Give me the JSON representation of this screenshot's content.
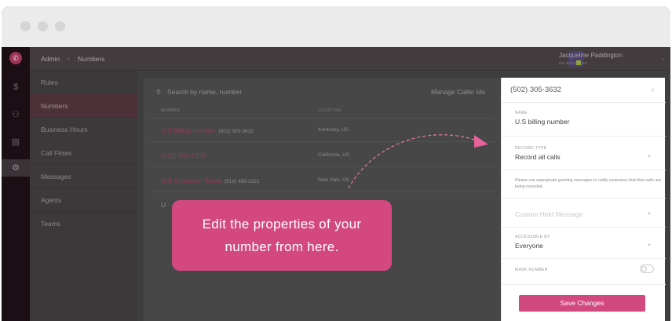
{
  "window": {
    "controls": [
      "close",
      "minimize",
      "maximize"
    ]
  },
  "rail": {
    "logo_icon": "phone-icon",
    "icons": [
      "dollar-icon",
      "people-icon",
      "card-icon",
      "gear-icon"
    ]
  },
  "breadcrumb": {
    "root": "Admin",
    "separator": "›",
    "current": "Numbers"
  },
  "user": {
    "name": "Jacqueline Paddington",
    "role": "ON BROWSER"
  },
  "sidebar": {
    "items": [
      {
        "label": "Rules"
      },
      {
        "label": "Numbers"
      },
      {
        "label": "Business Hours"
      },
      {
        "label": "Call Flows"
      },
      {
        "label": "Messages"
      },
      {
        "label": "Agents"
      },
      {
        "label": "Teams"
      }
    ],
    "active": "Numbers"
  },
  "main": {
    "search_placeholder": "Search by name, number",
    "manage_label": "Manage Caller Ids",
    "columns": {
      "number": "NUMBER",
      "location": "LOCATION"
    },
    "rows": [
      {
        "name": "U.S billing number",
        "number": "(502) 305-3632",
        "location": "Kentucky, US"
      },
      {
        "name": "(510) 592-5195",
        "number": "",
        "location": "California, US"
      },
      {
        "name": "U.S Customer Sales",
        "number": "(518) 499-3321",
        "location": "New York, US"
      },
      {
        "name": "U",
        "number": "",
        "location": ""
      }
    ]
  },
  "tooltip": {
    "line1": "Edit the properties of your",
    "line2": "number from here."
  },
  "panel": {
    "title": "(502) 305-3632",
    "close_icon": "×",
    "name_label": "NAME",
    "name_value": "U.S billing number",
    "record_label": "RECORD TYPE",
    "record_value": "Record all calls",
    "help_text": "Please use appropriate greeting messages to notify customers that their calls are being recorded.",
    "hold_placeholder": "Custom Hold Message",
    "access_label": "ACCESSIBLE BY",
    "access_value": "Everyone",
    "mask_label": "MASK NUMBER",
    "mask_enabled": false,
    "save_label": "Save Changes"
  },
  "colors": {
    "accent": "#d1497f",
    "rail": "#1b0e14",
    "overlay": "#3f3e3e"
  }
}
